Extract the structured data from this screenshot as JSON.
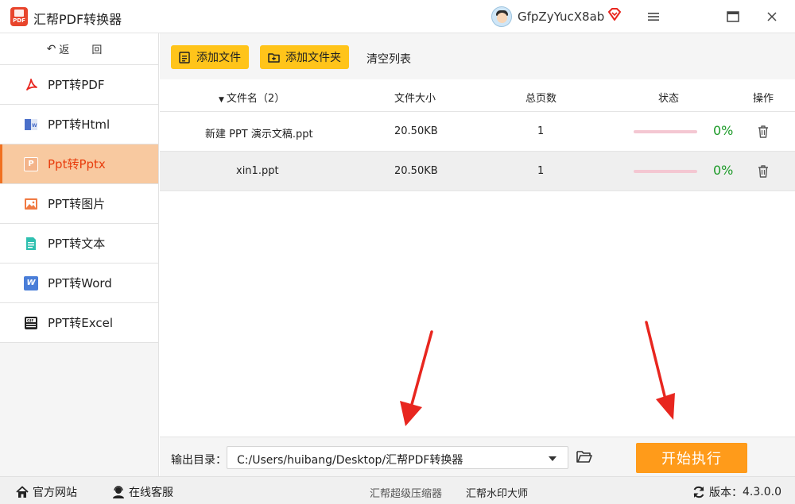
{
  "app": {
    "title": "汇帮PDF转换器",
    "logo_text": "PDF"
  },
  "user": {
    "name": "GfpZyYucX8ab"
  },
  "window_controls": {
    "menu_icon": "hamburger-icon",
    "maximize_icon": "maximize-icon",
    "close_icon": "close-icon"
  },
  "sidebar": {
    "back_label": "返 回",
    "items": [
      {
        "label": "PPT转PDF",
        "icon": "pdf-icon",
        "active": false
      },
      {
        "label": "PPT转Html",
        "icon": "html-icon",
        "active": false
      },
      {
        "label": "Ppt转Pptx",
        "icon": "pptx-icon",
        "active": true
      },
      {
        "label": "PPT转图片",
        "icon": "image-icon",
        "active": false
      },
      {
        "label": "PPT转文本",
        "icon": "text-icon",
        "active": false
      },
      {
        "label": "PPT转Word",
        "icon": "word-icon",
        "active": false
      },
      {
        "label": "PPT转Excel",
        "icon": "excel-icon",
        "active": false
      }
    ]
  },
  "toolbar": {
    "add_file": "添加文件",
    "add_folder": "添加文件夹",
    "clear_list": "清空列表"
  },
  "table": {
    "headers": {
      "filename": "文件名（2）",
      "size": "文件大小",
      "pages": "总页数",
      "status": "状态",
      "action": "操作"
    },
    "rows": [
      {
        "filename": "新建 PPT 演示文稿.ppt",
        "size": "20.50KB",
        "pages": "1",
        "progress_pct": 0,
        "progress_label": "0%"
      },
      {
        "filename": "xin1.ppt",
        "size": "20.50KB",
        "pages": "1",
        "progress_pct": 0,
        "progress_label": "0%"
      }
    ]
  },
  "output": {
    "label": "输出目录：",
    "path": "C:/Users/huibang/Desktop/汇帮PDF转换器",
    "start_label": "开始执行"
  },
  "statusbar": {
    "website": "官方网站",
    "service": "在线客服",
    "link_compress": "汇帮超级压缩器",
    "link_watermark": "汇帮水印大师",
    "version_label": "版本：",
    "version": "4.3.0.0"
  },
  "colors": {
    "accent": "#ff9b1a",
    "button_yellow": "#ffc41a",
    "active_bg": "#f8c9a0",
    "active_text": "#e83c0c",
    "progress_text": "#1c9a28",
    "arrow": "#e8261f"
  }
}
